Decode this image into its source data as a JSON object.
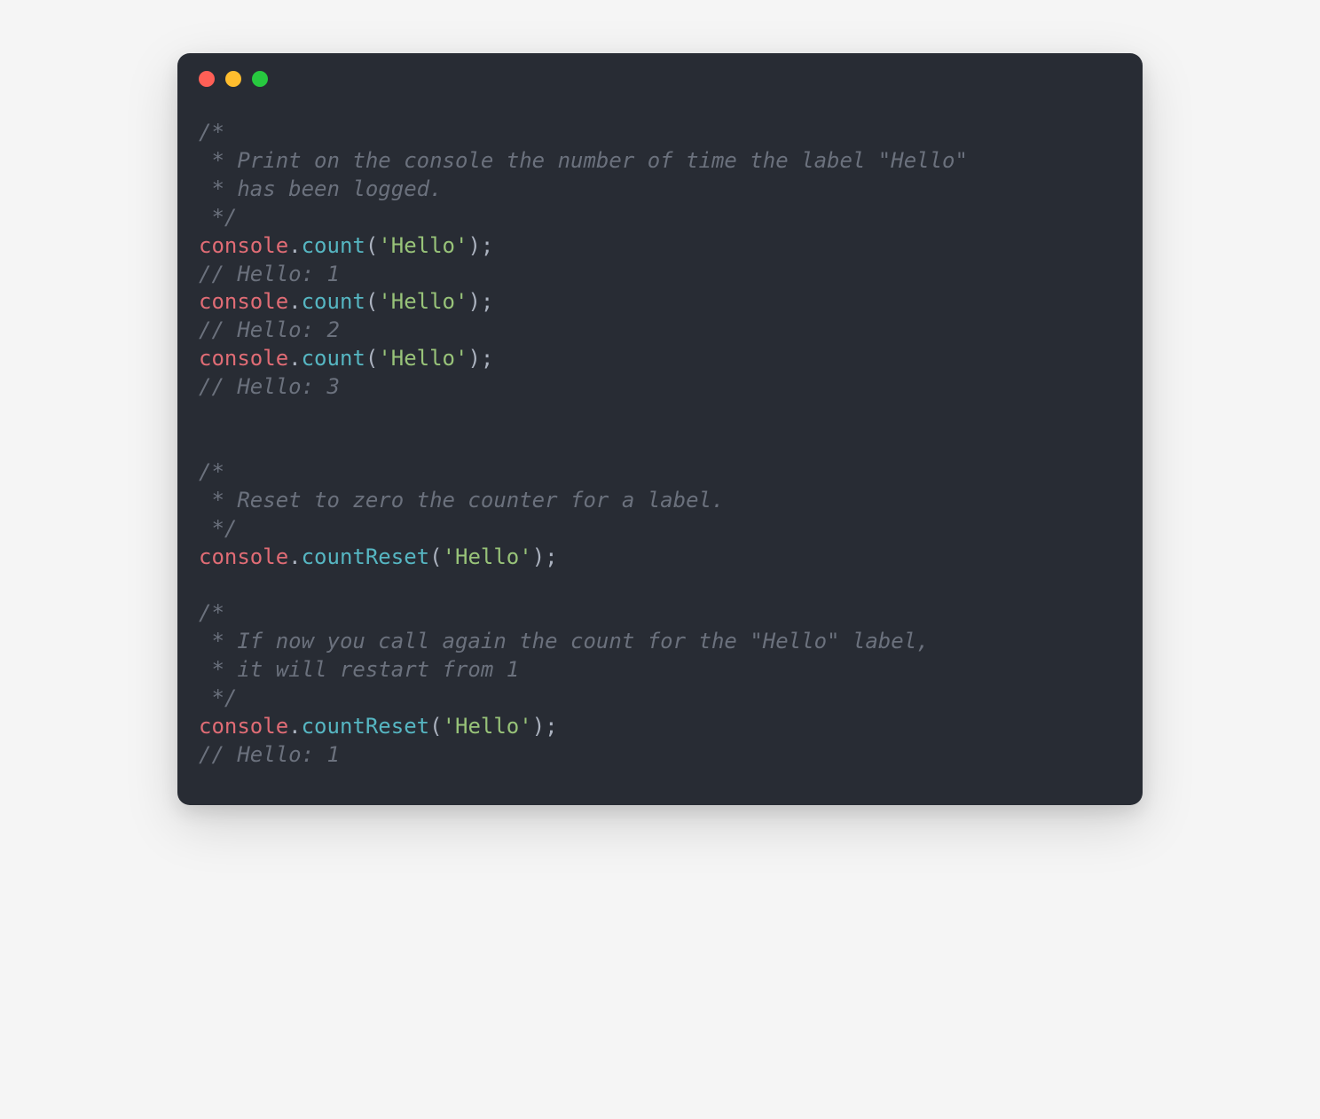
{
  "colors": {
    "bg": "#282c34",
    "comment": "#6b717d",
    "object": "#e06c75",
    "method": "#56b6c2",
    "string": "#98c379",
    "punct": "#abb2bf"
  },
  "titlebar": {
    "dots": [
      "red",
      "yellow",
      "green"
    ]
  },
  "code": {
    "tokens": [
      {
        "type": "comment",
        "text": "/*\n * Print on the console the number of time the label \"Hello\"\n * has been logged.\n */"
      },
      {
        "type": "newline",
        "text": "\n"
      },
      {
        "type": "object",
        "text": "console"
      },
      {
        "type": "punct",
        "text": "."
      },
      {
        "type": "method",
        "text": "count"
      },
      {
        "type": "punct",
        "text": "("
      },
      {
        "type": "string",
        "text": "'Hello'"
      },
      {
        "type": "punct",
        "text": ");"
      },
      {
        "type": "newline",
        "text": "\n"
      },
      {
        "type": "comment",
        "text": "// Hello: 1"
      },
      {
        "type": "newline",
        "text": "\n"
      },
      {
        "type": "object",
        "text": "console"
      },
      {
        "type": "punct",
        "text": "."
      },
      {
        "type": "method",
        "text": "count"
      },
      {
        "type": "punct",
        "text": "("
      },
      {
        "type": "string",
        "text": "'Hello'"
      },
      {
        "type": "punct",
        "text": ");"
      },
      {
        "type": "newline",
        "text": "\n"
      },
      {
        "type": "comment",
        "text": "// Hello: 2"
      },
      {
        "type": "newline",
        "text": "\n"
      },
      {
        "type": "object",
        "text": "console"
      },
      {
        "type": "punct",
        "text": "."
      },
      {
        "type": "method",
        "text": "count"
      },
      {
        "type": "punct",
        "text": "("
      },
      {
        "type": "string",
        "text": "'Hello'"
      },
      {
        "type": "punct",
        "text": ");"
      },
      {
        "type": "newline",
        "text": "\n"
      },
      {
        "type": "comment",
        "text": "// Hello: 3"
      },
      {
        "type": "newline",
        "text": "\n\n\n"
      },
      {
        "type": "comment",
        "text": "/*\n * Reset to zero the counter for a label.\n */"
      },
      {
        "type": "newline",
        "text": "\n"
      },
      {
        "type": "object",
        "text": "console"
      },
      {
        "type": "punct",
        "text": "."
      },
      {
        "type": "method",
        "text": "countReset"
      },
      {
        "type": "punct",
        "text": "("
      },
      {
        "type": "string",
        "text": "'Hello'"
      },
      {
        "type": "punct",
        "text": ");"
      },
      {
        "type": "newline",
        "text": "\n\n"
      },
      {
        "type": "comment",
        "text": "/*\n * If now you call again the count for the \"Hello\" label,\n * it will restart from 1\n */"
      },
      {
        "type": "newline",
        "text": "\n"
      },
      {
        "type": "object",
        "text": "console"
      },
      {
        "type": "punct",
        "text": "."
      },
      {
        "type": "method",
        "text": "countReset"
      },
      {
        "type": "punct",
        "text": "("
      },
      {
        "type": "string",
        "text": "'Hello'"
      },
      {
        "type": "punct",
        "text": ");"
      },
      {
        "type": "newline",
        "text": "\n"
      },
      {
        "type": "comment",
        "text": "// Hello: 1"
      }
    ]
  }
}
